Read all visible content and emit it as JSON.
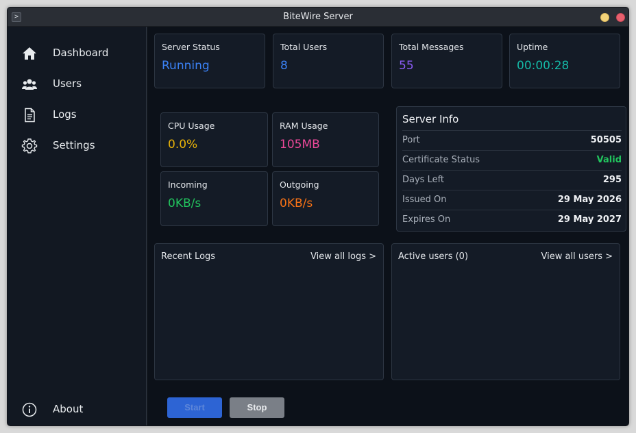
{
  "window": {
    "title": "BiteWire Server",
    "app_icon_glyph": ">"
  },
  "sidebar": {
    "items": [
      {
        "label": "Dashboard",
        "icon": "home-icon"
      },
      {
        "label": "Users",
        "icon": "users-icon"
      },
      {
        "label": "Logs",
        "icon": "document-icon"
      },
      {
        "label": "Settings",
        "icon": "gear-icon"
      }
    ],
    "about": {
      "label": "About",
      "icon": "info-icon"
    }
  },
  "stats": {
    "server_status": {
      "label": "Server Status",
      "value": "Running",
      "color": "#3b82f6"
    },
    "total_users": {
      "label": "Total Users",
      "value": "8",
      "color": "#3b82f6"
    },
    "total_messages": {
      "label": "Total Messages",
      "value": "55",
      "color": "#8b5cf6"
    },
    "uptime": {
      "label": "Uptime",
      "value": "00:00:28",
      "color": "#14b8a6"
    }
  },
  "resources": {
    "cpu": {
      "label": "CPU Usage",
      "value": "0.0%",
      "color": "#eab308"
    },
    "ram": {
      "label": "RAM Usage",
      "value": "105MB",
      "color": "#ec4899"
    },
    "incoming": {
      "label": "Incoming",
      "value": "0KB/s",
      "color": "#22c55e"
    },
    "outgoing": {
      "label": "Outgoing",
      "value": "0KB/s",
      "color": "#f97316"
    }
  },
  "server_info": {
    "title": "Server Info",
    "rows": [
      {
        "key": "Port",
        "value": "50505"
      },
      {
        "key": "Certificate Status",
        "value": "Valid",
        "color": "#22c55e"
      },
      {
        "key": "Days Left",
        "value": "295"
      },
      {
        "key": "Issued On",
        "value": "29 May 2026"
      },
      {
        "key": "Expires On",
        "value": "29 May 2027"
      }
    ]
  },
  "recent_logs": {
    "title": "Recent Logs",
    "link": "View all logs >"
  },
  "active_users": {
    "title": "Active users (0)",
    "link": "View all users >"
  },
  "controls": {
    "start_label": "Start",
    "stop_label": "Stop"
  }
}
